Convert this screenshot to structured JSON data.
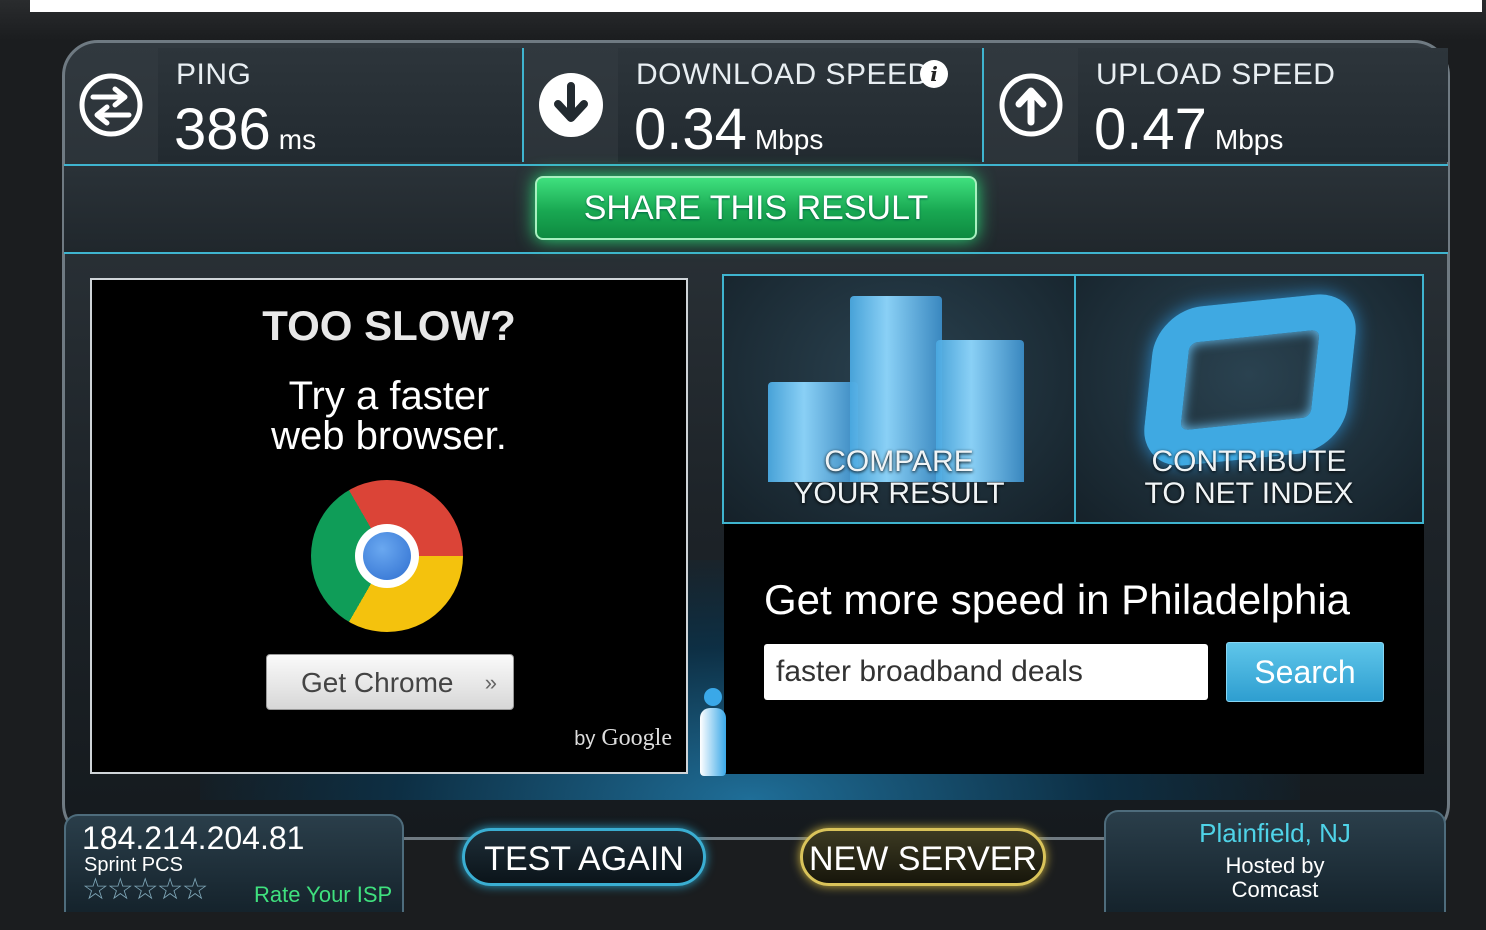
{
  "stats": {
    "ping": {
      "label": "PING",
      "value": "386",
      "unit": "ms",
      "icon": "swap-arrows-icon"
    },
    "download": {
      "label": "DOWNLOAD SPEED",
      "value": "0.34",
      "unit": "Mbps",
      "icon": "download-arrow-icon",
      "info": "i"
    },
    "upload": {
      "label": "UPLOAD SPEED",
      "value": "0.47",
      "unit": "Mbps",
      "icon": "upload-arrow-icon"
    }
  },
  "share_label": "SHARE THIS RESULT",
  "ad": {
    "title": "TOO SLOW?",
    "subtitle_line1": "Try a faster",
    "subtitle_line2": "web browser.",
    "button_label": "Get Chrome",
    "button_chevron": "»",
    "by": "by",
    "brand": "Google"
  },
  "tiles": {
    "compare_line1": "COMPARE",
    "compare_line2": "YOUR RESULT",
    "contribute_line1": "CONTRIBUTE",
    "contribute_line2": "TO NET INDEX"
  },
  "search": {
    "title": "Get more speed in Philadelphia",
    "input_value": "faster broadband deals",
    "button_label": "Search"
  },
  "connection": {
    "ip": "184.214.204.81",
    "isp": "Sprint PCS",
    "stars": "☆☆☆☆☆",
    "rate_label": "Rate Your ISP"
  },
  "actions": {
    "test_again": "TEST AGAIN",
    "new_server": "NEW SERVER"
  },
  "server": {
    "city": "Plainfield, NJ",
    "hosted_line1": "Hosted by",
    "hosted_line2": "Comcast"
  },
  "colors": {
    "accent": "#3fb4cf",
    "share_green": "#19a852",
    "rate_green": "#3fe07e",
    "server_gold": "#d9c35a"
  }
}
